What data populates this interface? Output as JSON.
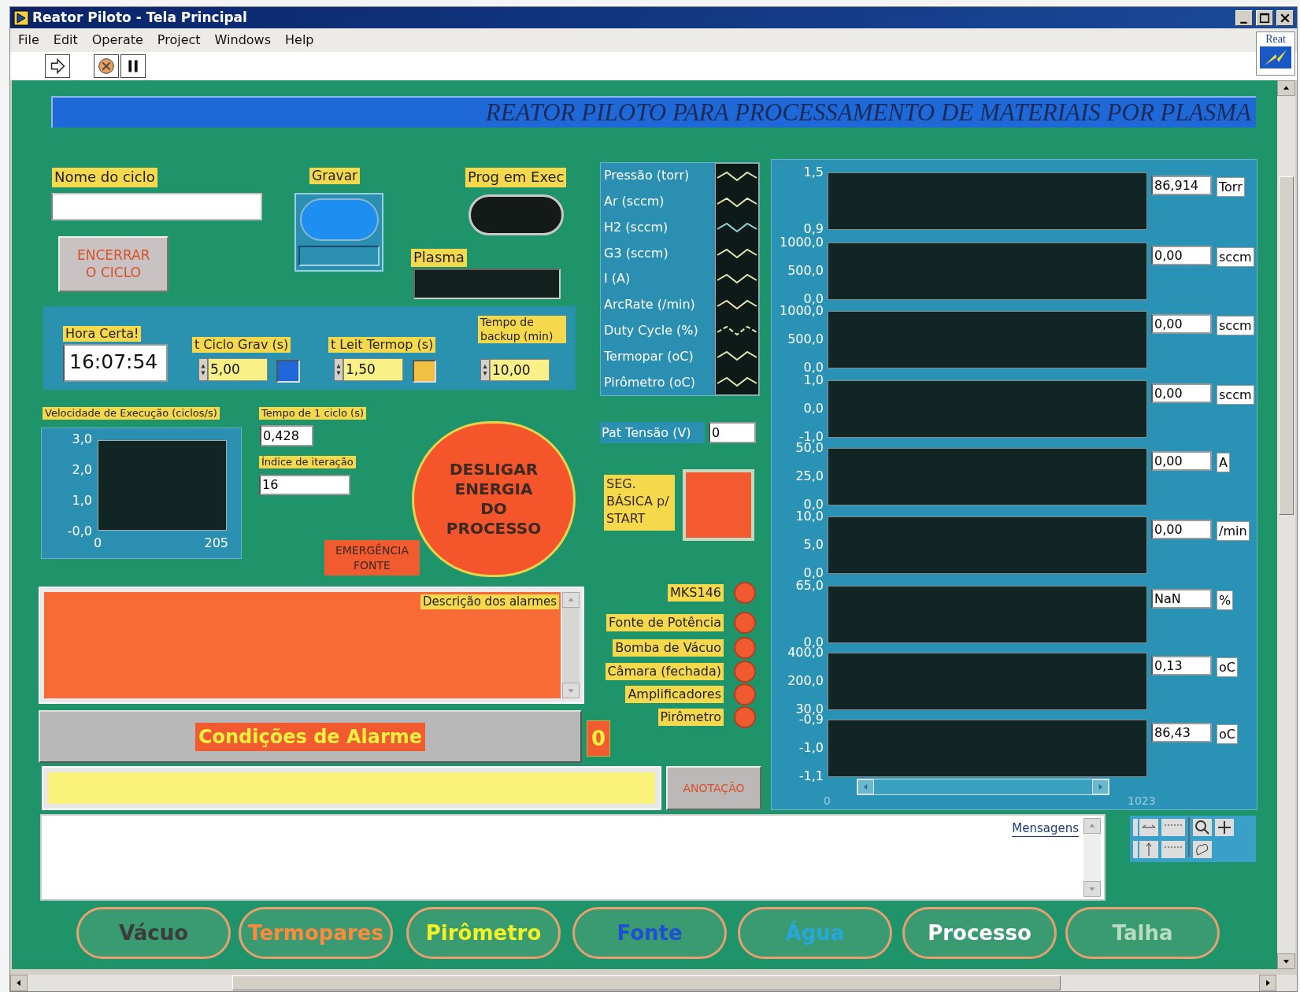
{
  "window": {
    "title": "Reator Piloto - Tela Principal"
  },
  "menu": [
    "File",
    "Edit",
    "Operate",
    "Project",
    "Windows",
    "Help"
  ],
  "logo": {
    "text": "Reat"
  },
  "banner": "REATOR PILOTO PARA PROCESSAMENTO DE MATERIAIS POR PLASMA",
  "cycle_name": {
    "label": "Nome do ciclo"
  },
  "end_cycle_button": "ENCERRAR O CICLO",
  "record": {
    "label": "Gravar",
    "on": true
  },
  "running": {
    "label": "Prog  em Exec",
    "on": false
  },
  "plasma": {
    "label": "Plasma"
  },
  "clock": {
    "label": "Hora Certa!",
    "value": "16:07:54"
  },
  "timers": [
    {
      "label": "t Ciclo Grav (s)",
      "value": "5,00",
      "color": "#1f66d8"
    },
    {
      "label": "t Leit  Termop (s)",
      "value": "1,50",
      "color": "#f0c040"
    }
  ],
  "backup": {
    "label": "Tempo de backup (min)",
    "value": "10,00"
  },
  "speed_chart": {
    "label": "Velocidade de Execução (ciclos/s)",
    "y_ticks": [
      "3,0",
      "2,0",
      "1,0",
      "-0,0"
    ],
    "x_ticks": [
      "0",
      "205"
    ]
  },
  "cycle_time": {
    "label": "Tempo de 1 ciclo (s)",
    "value": "0,428"
  },
  "iteration": {
    "label": "Índice de iteração",
    "value": "16"
  },
  "shutdown_button": "DESLIGAR ENERGIA DO PROCESSO",
  "emergency_button": "EMERGÊNCIA FONTE",
  "alarm_list": {
    "label": "Descrição dos alarmes"
  },
  "alarm_conditions": {
    "label": "Condições de Alarme",
    "count": "0"
  },
  "annotation_button": "ANOTAÇÃO",
  "messages": {
    "label": "Mensagens"
  },
  "legend": [
    {
      "name": "Pressão (torr)",
      "kind": "solid",
      "color": "#e6e6b0"
    },
    {
      "name": "Ar (sccm)",
      "kind": "solid",
      "color": "#e6e6b0"
    },
    {
      "name": "H2 (sccm)",
      "kind": "solid",
      "color": "#8fd8e0"
    },
    {
      "name": "G3 (sccm)",
      "kind": "solid",
      "color": "#e6e6b0"
    },
    {
      "name": "I (A)",
      "kind": "solid",
      "color": "#e6e6b0"
    },
    {
      "name": "ArcRate (/min)",
      "kind": "solid",
      "color": "#e6e6b0"
    },
    {
      "name": "Duty Cycle (%)",
      "kind": "dotted",
      "color": "#e6e6b0"
    },
    {
      "name": "Termopar (oC)",
      "kind": "solid",
      "color": "#e6e6b0"
    },
    {
      "name": "Pirômetro (oC)",
      "kind": "solid",
      "color": "#e6e6b0"
    }
  ],
  "voltage": {
    "label": "Pat Tensão (V)",
    "value": "0"
  },
  "start_safety": {
    "label": "SEG. BÁSICA p/ START"
  },
  "status_leds": [
    {
      "label": "MKS146",
      "on": true
    },
    {
      "label": "Fonte de Potência",
      "on": true
    },
    {
      "label": "Bomba de Vácuo",
      "on": true
    },
    {
      "label": "Câmara (fechada)",
      "on": true
    },
    {
      "label": "Amplificadores",
      "on": true
    },
    {
      "label": "Pirômetro",
      "on": true
    }
  ],
  "strips": [
    {
      "y_ticks": [
        "1,5",
        "0,9"
      ],
      "value": "86,914",
      "unit": "Torr"
    },
    {
      "y_ticks": [
        "1000,0",
        "500,0",
        "0,0"
      ],
      "value": "0,00",
      "unit": "sccm"
    },
    {
      "y_ticks": [
        "1000,0",
        "500,0",
        "0,0"
      ],
      "value": "0,00",
      "unit": "sccm"
    },
    {
      "y_ticks": [
        "1,0",
        "0,0",
        "-1,0"
      ],
      "value": "0,00",
      "unit": "sccm"
    },
    {
      "y_ticks": [
        "50,0",
        "25,0",
        "0,0"
      ],
      "value": "0,00",
      "unit": "A"
    },
    {
      "y_ticks": [
        "10,0",
        "5,0",
        "0,0"
      ],
      "value": "0,00",
      "unit": "/min"
    },
    {
      "y_ticks": [
        "65,0",
        "0,0"
      ],
      "value": "NaN",
      "unit": "%"
    },
    {
      "y_ticks": [
        "400,0",
        "200,0",
        "30,0"
      ],
      "value": "0,13",
      "unit": "oC"
    },
    {
      "y_ticks": [
        "-0,9",
        "-1,0",
        "-1,1"
      ],
      "value": "86,43",
      "unit": "oC"
    }
  ],
  "strip_x_ticks": [
    "0",
    "1023"
  ],
  "nav_buttons": [
    {
      "label": "Vácuo",
      "color": "#3c3c3c"
    },
    {
      "label": "Termopares",
      "color": "#ff8a3c"
    },
    {
      "label": "Pirômetro",
      "color": "#f2f224"
    },
    {
      "label": "Fonte",
      "color": "#1f4fd2"
    },
    {
      "label": "Água",
      "color": "#27a8dc"
    },
    {
      "label": "Processo",
      "color": "#ffffff"
    },
    {
      "label": "Talha",
      "color": "#b8dcc0"
    }
  ]
}
